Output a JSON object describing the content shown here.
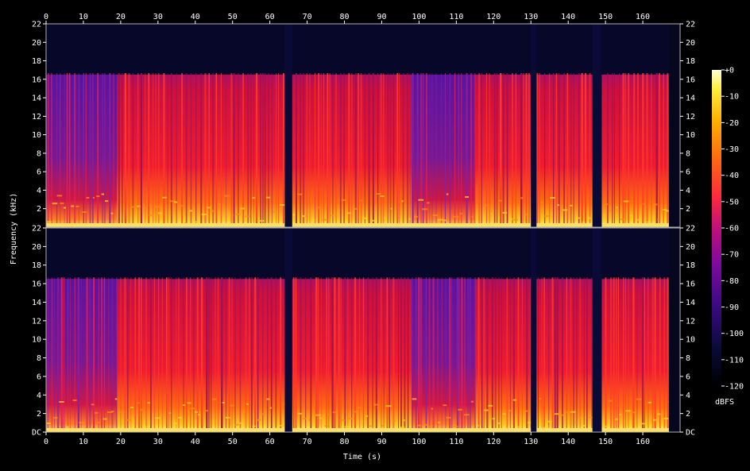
{
  "chart_data": {
    "type": "heatmap",
    "subtype": "spectrogram",
    "channels": 2,
    "xlabel": "Time (s)",
    "ylabel": "Frequency (kHz)",
    "colorbar_label": "dBFS",
    "x_ticks": [
      0,
      10,
      20,
      30,
      40,
      50,
      60,
      70,
      80,
      90,
      100,
      110,
      120,
      130,
      140,
      150,
      160
    ],
    "x_range": [
      0,
      170
    ],
    "y_tick_labels_top_channel": [
      "2",
      "4",
      "6",
      "8",
      "10",
      "12",
      "14",
      "16",
      "18",
      "20",
      "22"
    ],
    "y_tick_labels_bottom_channel": [
      "DC",
      "2",
      "4",
      "6",
      "8",
      "10",
      "12",
      "14",
      "16",
      "18",
      "20",
      "22"
    ],
    "y_range_khz": [
      0,
      22
    ],
    "colorbar_ticks": [
      "+0",
      "-10",
      "-20",
      "-30",
      "-40",
      "-50",
      "-60",
      "-70",
      "-80",
      "-90",
      "-100",
      "-110",
      "-120"
    ],
    "colorbar_range_dbfs": [
      -120,
      0
    ],
    "lowpass_cutoff_khz": 16.5,
    "audio_end_s": 167,
    "silent_gaps_s": [
      [
        64,
        66
      ],
      [
        130,
        131.5
      ],
      [
        146.5,
        149
      ]
    ],
    "quieter_sections_s": [
      [
        0,
        19
      ],
      [
        98,
        115
      ]
    ],
    "colors": {
      "background": "#000000",
      "text": "#ffffff",
      "colormap": [
        "#000000",
        "#0a0a3a",
        "#3a0a80",
        "#7a0aa0",
        "#c0107a",
        "#ff2a3a",
        "#ff6a10",
        "#ffb000",
        "#ffee40",
        "#ffffd8"
      ]
    }
  }
}
